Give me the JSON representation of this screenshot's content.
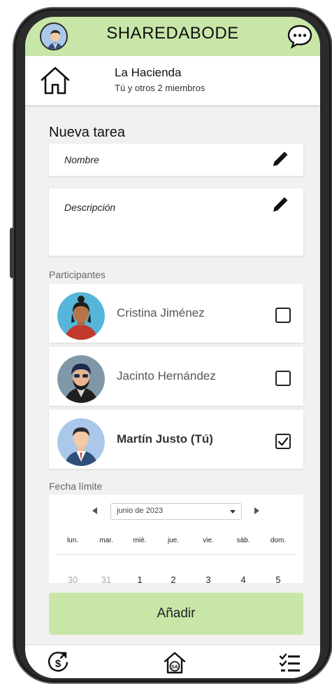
{
  "header": {
    "app_title": "SHAREDABODE"
  },
  "house": {
    "name": "La Hacienda",
    "members": "Tú y otros 2 miembros"
  },
  "form": {
    "section_title": "Nueva tarea",
    "name_placeholder": "Nombre",
    "description_placeholder": "Descripción",
    "participants_label": "Participantes",
    "deadline_label": "Fecha límite",
    "submit_label": "Añadir"
  },
  "participants": [
    {
      "name": "Cristina Jiménez",
      "checked": false
    },
    {
      "name": "Jacinto Hernández",
      "checked": false
    },
    {
      "name": "Martín Justo (Tú)",
      "checked": true
    }
  ],
  "calendar": {
    "month": "junio de 2023",
    "weekdays": [
      "lun.",
      "mar.",
      "mié.",
      "jue.",
      "vie.",
      "sáb.",
      "dom."
    ],
    "first_row": [
      "30",
      "31",
      "1",
      "2",
      "3",
      "4",
      "5"
    ]
  },
  "colors": {
    "accent": "#c8e6a8",
    "background": "#f1f1f1"
  },
  "icons": {
    "top_left": "user-avatar",
    "top_right": "chat-icon",
    "house": "house-icon",
    "bottom_nav": [
      "expenses-icon",
      "home-sa-icon",
      "tasks-icon"
    ]
  }
}
